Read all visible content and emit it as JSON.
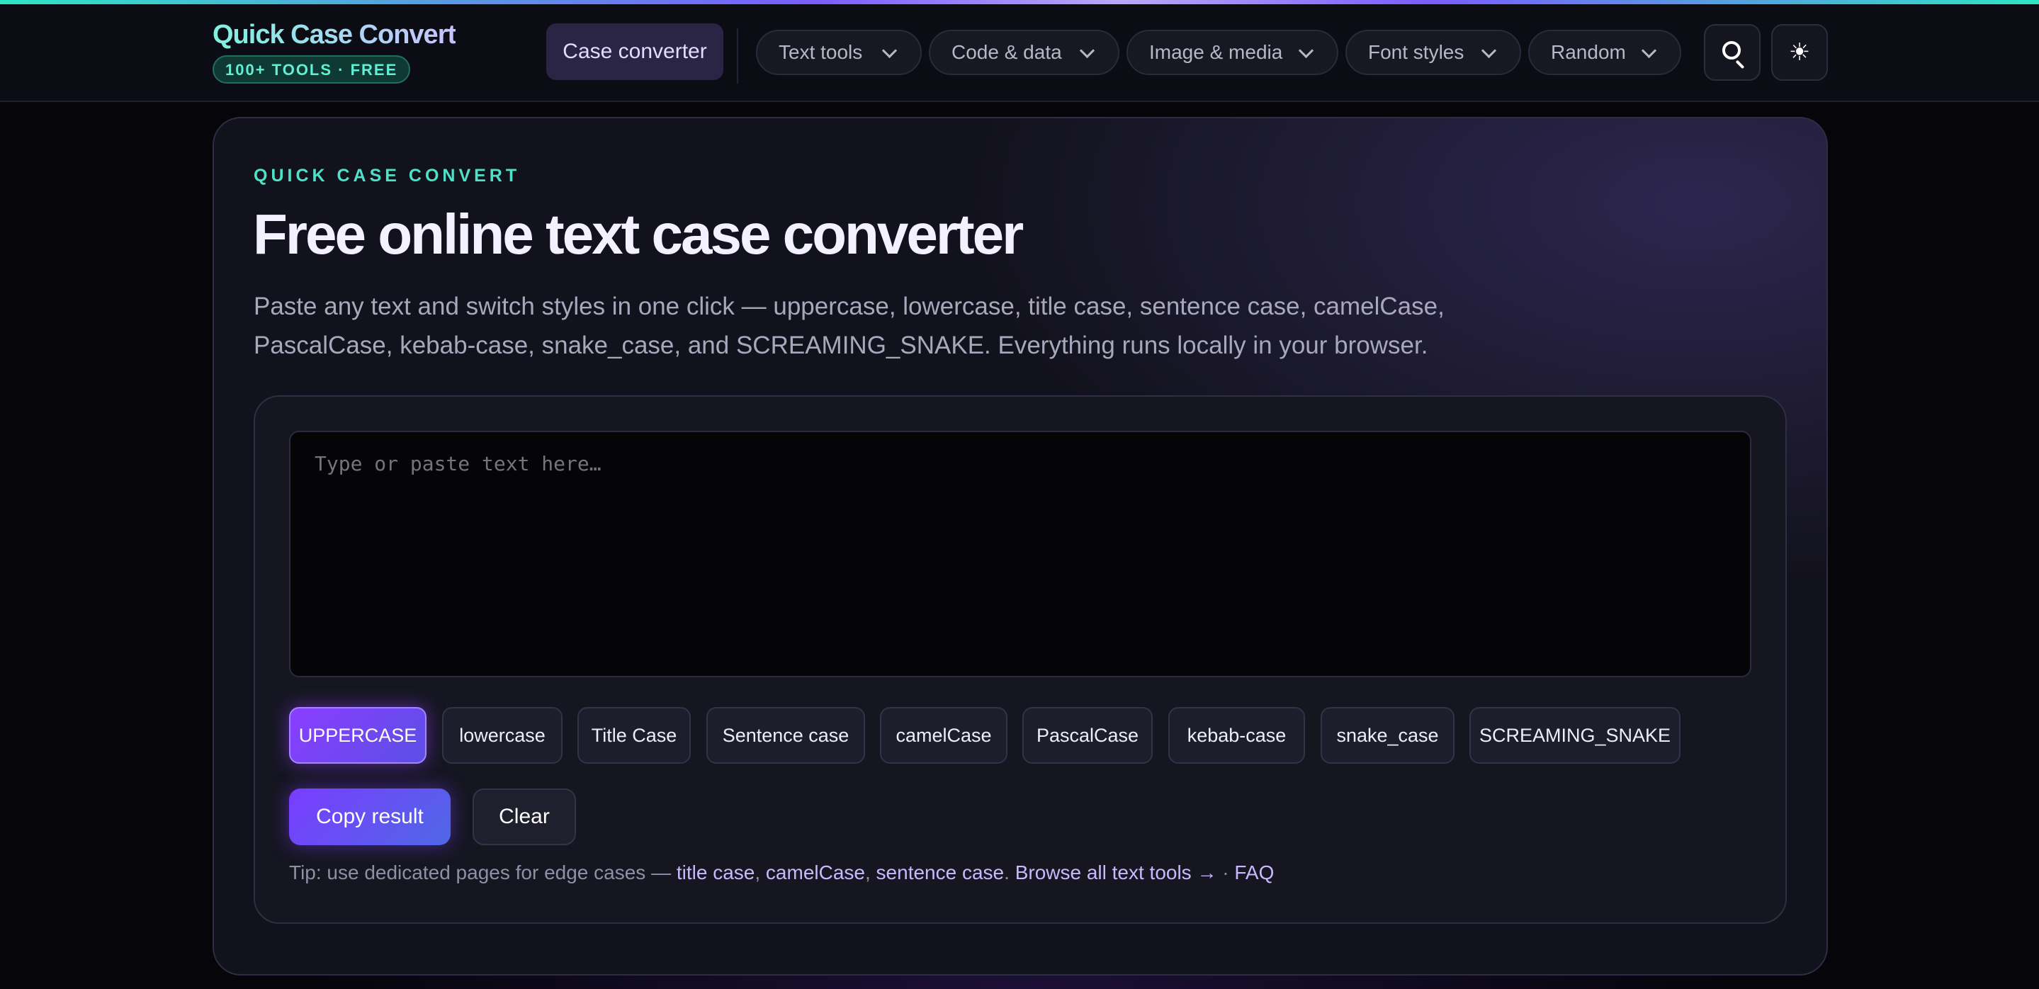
{
  "brand": {
    "title": "Quick Case Convert",
    "badge": "100+ TOOLS · FREE"
  },
  "nav": {
    "active": "Case converter",
    "menus": [
      {
        "label": "Text tools",
        "icon": "chevron-down-icon"
      },
      {
        "label": "Code & data",
        "icon": "chevron-down-icon"
      },
      {
        "label": "Image & media",
        "icon": "chevron-down-icon"
      },
      {
        "label": "Font styles",
        "icon": "chevron-down-icon"
      },
      {
        "label": "Random",
        "icon": "chevron-down-icon"
      }
    ],
    "search_icon": "search-icon",
    "theme_icon": "sun-icon",
    "theme_glyph": "☀"
  },
  "hero": {
    "eyebrow": "QUICK CASE CONVERT",
    "title": "Free online text case converter",
    "lede_line1": "Paste any text and switch styles in one click — uppercase, lowercase, title case, sentence case, camelCase,",
    "lede_line2": "PascalCase, kebab-case, snake_case, and SCREAMING_SNAKE. Everything runs locally in your browser."
  },
  "tool": {
    "input_value": "",
    "input_placeholder": "Type or paste text here…",
    "cases": [
      {
        "label": "UPPERCASE",
        "active": true
      },
      {
        "label": "lowercase",
        "active": false
      },
      {
        "label": "Title Case",
        "active": false
      },
      {
        "label": "Sentence case",
        "active": false
      },
      {
        "label": "camelCase",
        "active": false
      },
      {
        "label": "PascalCase",
        "active": false
      },
      {
        "label": "kebab-case",
        "active": false
      },
      {
        "label": "snake_case",
        "active": false
      },
      {
        "label": "SCREAMING_SNAKE",
        "active": false
      }
    ],
    "copy_label": "Copy result",
    "clear_label": "Clear"
  },
  "tip": {
    "prefix": "Tip: use dedicated pages for edge cases — ",
    "link_title_case": "title case",
    "sep1": ", ",
    "link_camel_case": "camelCase",
    "sep2": ", ",
    "link_sentence_case": "sentence case",
    "sep3": ". ",
    "link_browse": "Browse all text tools →",
    "sep4": " · ",
    "link_faq": "FAQ"
  },
  "colors": {
    "accent_purple": "#8b3dff",
    "accent_teal": "#4fe0c8",
    "background": "#05050a",
    "card": "#12121c"
  }
}
